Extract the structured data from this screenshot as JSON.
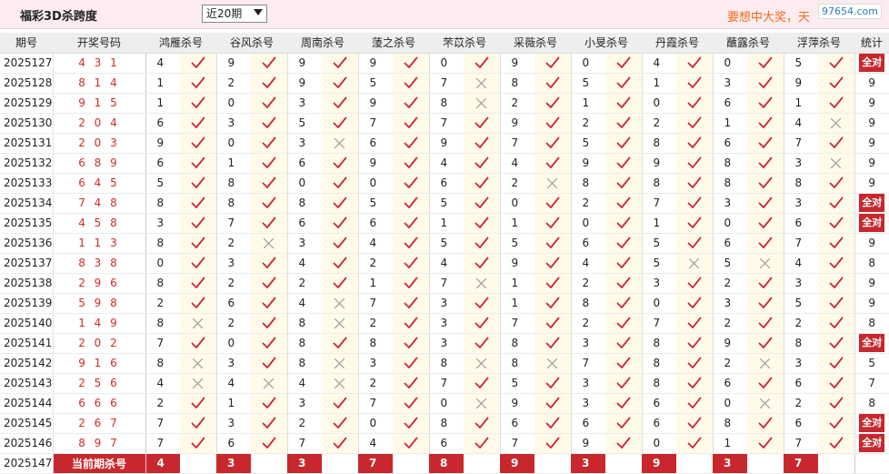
{
  "header": {
    "title": "福彩3D杀跨度",
    "period_select": "近20期",
    "promo_text": "要想中大奖，天",
    "watermark": "97654.com"
  },
  "table": {
    "col_issue": "期号",
    "col_code": "开奖号码",
    "experts": [
      "鸿雁杀号",
      "谷风杀号",
      "周南杀号",
      "蔆之杀号",
      "芣苡杀号",
      "采薇杀号",
      "小旻杀号",
      "丹霞杀号",
      "蘸露杀号",
      "浮萍杀号"
    ],
    "col_stat": "统计",
    "full_label": "全对",
    "rows": [
      {
        "issue": "2025127",
        "code": "4 3 1",
        "picks": [
          4,
          9,
          9,
          9,
          0,
          9,
          0,
          4,
          0,
          5
        ],
        "hits": [
          1,
          1,
          1,
          1,
          1,
          1,
          1,
          1,
          1,
          1
        ],
        "stat": "全对"
      },
      {
        "issue": "2025128",
        "code": "8 1 4",
        "picks": [
          1,
          2,
          9,
          5,
          7,
          8,
          5,
          1,
          3,
          9
        ],
        "hits": [
          1,
          1,
          1,
          1,
          0,
          1,
          1,
          1,
          1,
          1
        ],
        "stat": "9"
      },
      {
        "issue": "2025129",
        "code": "9 1 5",
        "picks": [
          1,
          0,
          3,
          9,
          8,
          2,
          1,
          0,
          6,
          1
        ],
        "hits": [
          1,
          1,
          1,
          1,
          0,
          1,
          1,
          1,
          1,
          1
        ],
        "stat": "9"
      },
      {
        "issue": "2025130",
        "code": "2 0 4",
        "picks": [
          6,
          3,
          5,
          7,
          7,
          9,
          2,
          2,
          1,
          4
        ],
        "hits": [
          1,
          1,
          1,
          1,
          1,
          1,
          1,
          1,
          1,
          0
        ],
        "stat": "9"
      },
      {
        "issue": "2025131",
        "code": "2 0 3",
        "picks": [
          9,
          0,
          3,
          6,
          9,
          7,
          5,
          8,
          6,
          7
        ],
        "hits": [
          1,
          1,
          0,
          1,
          1,
          1,
          1,
          1,
          1,
          1
        ],
        "stat": "9"
      },
      {
        "issue": "2025132",
        "code": "6 8 9",
        "picks": [
          6,
          1,
          6,
          9,
          4,
          4,
          9,
          9,
          8,
          3
        ],
        "hits": [
          1,
          1,
          1,
          1,
          1,
          1,
          1,
          1,
          1,
          0
        ],
        "stat": "9"
      },
      {
        "issue": "2025133",
        "code": "6 4 5",
        "picks": [
          5,
          8,
          0,
          0,
          6,
          2,
          8,
          8,
          8,
          8
        ],
        "hits": [
          1,
          1,
          1,
          1,
          1,
          0,
          1,
          1,
          1,
          1
        ],
        "stat": "9"
      },
      {
        "issue": "2025134",
        "code": "7 4 8",
        "picks": [
          8,
          8,
          8,
          5,
          5,
          0,
          2,
          7,
          3,
          3
        ],
        "hits": [
          1,
          1,
          1,
          1,
          1,
          1,
          1,
          1,
          1,
          1
        ],
        "stat": "全对"
      },
      {
        "issue": "2025135",
        "code": "4 5 8",
        "picks": [
          3,
          7,
          6,
          6,
          1,
          1,
          0,
          1,
          0,
          6
        ],
        "hits": [
          1,
          1,
          1,
          1,
          1,
          1,
          1,
          1,
          1,
          1
        ],
        "stat": "全对"
      },
      {
        "issue": "2025136",
        "code": "1 1 3",
        "picks": [
          8,
          2,
          3,
          4,
          5,
          5,
          6,
          5,
          6,
          7
        ],
        "hits": [
          1,
          0,
          1,
          1,
          1,
          1,
          1,
          1,
          1,
          1
        ],
        "stat": "9"
      },
      {
        "issue": "2025137",
        "code": "8 3 8",
        "picks": [
          0,
          3,
          4,
          2,
          4,
          9,
          4,
          5,
          5,
          4
        ],
        "hits": [
          1,
          1,
          1,
          1,
          1,
          1,
          1,
          0,
          0,
          1
        ],
        "stat": "8"
      },
      {
        "issue": "2025138",
        "code": "2 9 6",
        "picks": [
          8,
          2,
          2,
          1,
          7,
          1,
          2,
          3,
          2,
          3
        ],
        "hits": [
          1,
          1,
          1,
          1,
          0,
          1,
          1,
          1,
          1,
          1
        ],
        "stat": "9"
      },
      {
        "issue": "2025139",
        "code": "5 9 8",
        "picks": [
          2,
          6,
          4,
          7,
          3,
          1,
          8,
          0,
          3,
          5
        ],
        "hits": [
          1,
          1,
          0,
          1,
          1,
          1,
          1,
          1,
          1,
          1
        ],
        "stat": "9"
      },
      {
        "issue": "2025140",
        "code": "1 4 9",
        "picks": [
          8,
          2,
          8,
          2,
          3,
          7,
          2,
          7,
          2,
          2
        ],
        "hits": [
          0,
          1,
          0,
          1,
          1,
          1,
          1,
          1,
          1,
          1
        ],
        "stat": "8"
      },
      {
        "issue": "2025141",
        "code": "2 0 2",
        "picks": [
          7,
          0,
          8,
          8,
          3,
          8,
          3,
          8,
          9,
          8
        ],
        "hits": [
          1,
          1,
          1,
          1,
          1,
          1,
          1,
          1,
          1,
          1
        ],
        "stat": "全对"
      },
      {
        "issue": "2025142",
        "code": "9 1 6",
        "picks": [
          8,
          3,
          8,
          3,
          8,
          8,
          7,
          8,
          2,
          3
        ],
        "hits": [
          0,
          1,
          0,
          1,
          0,
          0,
          1,
          1,
          0,
          1
        ],
        "stat": "5"
      },
      {
        "issue": "2025143",
        "code": "2 5 6",
        "picks": [
          4,
          4,
          4,
          2,
          7,
          5,
          3,
          8,
          6,
          6
        ],
        "hits": [
          0,
          0,
          0,
          1,
          1,
          1,
          1,
          1,
          1,
          1
        ],
        "stat": "7"
      },
      {
        "issue": "2025144",
        "code": "6 6 6",
        "picks": [
          2,
          1,
          3,
          7,
          0,
          9,
          3,
          6,
          0,
          2
        ],
        "hits": [
          1,
          1,
          1,
          1,
          0,
          1,
          1,
          1,
          0,
          1
        ],
        "stat": "8"
      },
      {
        "issue": "2025145",
        "code": "2 6 7",
        "picks": [
          7,
          3,
          2,
          0,
          8,
          6,
          6,
          6,
          8,
          6
        ],
        "hits": [
          1,
          1,
          1,
          1,
          1,
          1,
          1,
          1,
          1,
          1
        ],
        "stat": "全对"
      },
      {
        "issue": "2025146",
        "code": "8 9 7",
        "picks": [
          7,
          6,
          7,
          4,
          6,
          7,
          9,
          0,
          1,
          7
        ],
        "hits": [
          1,
          1,
          1,
          1,
          1,
          1,
          1,
          1,
          1,
          1
        ],
        "stat": "全对"
      }
    ],
    "footer": {
      "issue": "2025147",
      "label": "当前期杀号",
      "picks": [
        4,
        3,
        3,
        7,
        8,
        9,
        3,
        9,
        3,
        7
      ]
    }
  }
}
